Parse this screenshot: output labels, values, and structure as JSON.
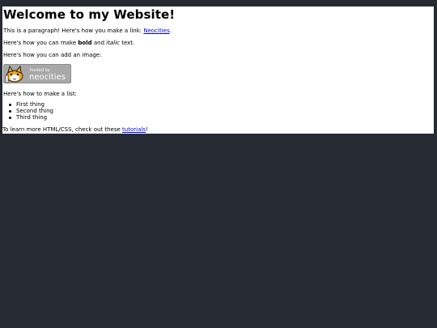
{
  "header": {
    "title": "Welcome to my Website!"
  },
  "para1": {
    "text": "This is a paragraph! Here's how you make a link: ",
    "link": "Neocities",
    "end": "."
  },
  "para2": {
    "pre": "Here's how you can make ",
    "bold": "bold",
    "mid": " and ",
    "italic": "italic",
    "post": " text."
  },
  "para3": {
    "text": "Here's how you can add an image:"
  },
  "badge": {
    "small": "hosted by",
    "big": "neocities"
  },
  "para4": {
    "text": "Here's how to make a list:"
  },
  "list": {
    "items": [
      "First thing",
      "Second thing",
      "Third thing"
    ]
  },
  "para5": {
    "pre": "To learn more HTML/CSS, check out these ",
    "link": "tutorials",
    "post": "!"
  },
  "colors": {
    "background": "#262a33",
    "link": "#0000ee",
    "badge": "#a8a8a8"
  }
}
